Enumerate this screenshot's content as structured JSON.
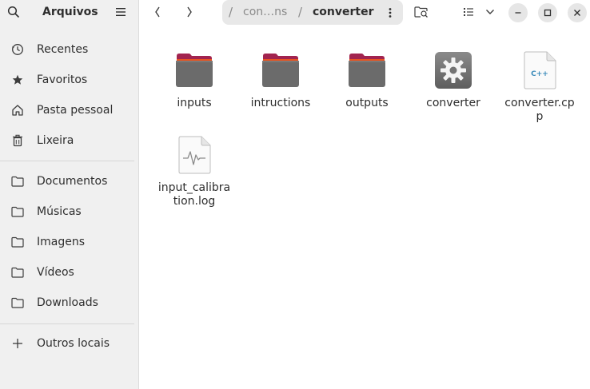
{
  "app": {
    "title": "Arquivos"
  },
  "sidebar": {
    "items": [
      {
        "label": "Recentes",
        "icon": "clock-icon"
      },
      {
        "label": "Favoritos",
        "icon": "star-icon"
      },
      {
        "label": "Pasta pessoal",
        "icon": "home-icon"
      },
      {
        "label": "Lixeira",
        "icon": "trash-icon"
      },
      {
        "label": "Documentos",
        "icon": "folder-icon"
      },
      {
        "label": "Músicas",
        "icon": "folder-icon"
      },
      {
        "label": "Imagens",
        "icon": "folder-icon"
      },
      {
        "label": "Vídeos",
        "icon": "folder-icon"
      },
      {
        "label": "Downloads",
        "icon": "folder-icon"
      },
      {
        "label": "Outros locais",
        "icon": "plus-icon"
      }
    ]
  },
  "path": {
    "root_sep": "/",
    "parent": "con…ns",
    "sep": "/",
    "current": "converter"
  },
  "files": [
    {
      "name": "inputs",
      "type": "folder"
    },
    {
      "name": "intructions",
      "type": "folder"
    },
    {
      "name": "outputs",
      "type": "folder"
    },
    {
      "name": "converter",
      "type": "executable"
    },
    {
      "name": "converter.cpp",
      "type": "cpp-source",
      "badge": "C++"
    },
    {
      "name": "input_calibration.log",
      "type": "log"
    }
  ],
  "colors": {
    "folder_body": "#6b6b6b",
    "folder_tab": "#a2244f",
    "folder_accent": "#e95420",
    "sidebar_bg": "#f0f0f0",
    "pathbar_bg": "#e8e8e8"
  }
}
